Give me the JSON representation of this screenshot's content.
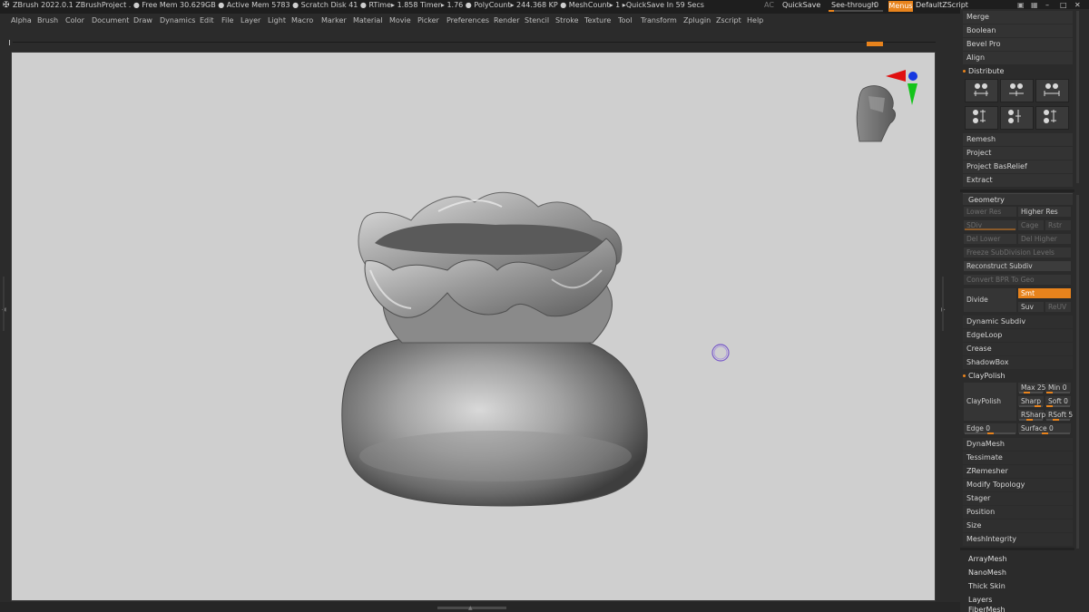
{
  "titlebar": {
    "title": "ZBrush 2022.0.1   ZBrushProject   . ● Free Mem 30.629GB ● Active Mem 5783 ● Scratch Disk 41 ●  RTime▸ 1.858 Timer▸ 1.76 ● PolyCount▸ 244.368 KP  ● MeshCount▸ 1   ▸QuickSave In 59 Secs",
    "ac": "AC",
    "quicksave": "QuickSave",
    "seethrough": "See-through",
    "seethrough_value": "0",
    "menus": "Menus",
    "defaultzscript": "DefaultZScript"
  },
  "menubar": [
    "Alpha",
    "Brush",
    "Color",
    "Document",
    "Draw",
    "Dynamics",
    "Edit",
    "File",
    "Layer",
    "Light",
    "Macro",
    "Marker",
    "Material",
    "Movie",
    "Picker",
    "Preferences",
    "Render",
    "Stencil",
    "Stroke",
    "Texture",
    "Tool",
    "Transform",
    "Zplugin",
    "Zscript",
    "Help"
  ],
  "palette": {
    "top_buttons": [
      "Merge",
      "Boolean",
      "Bevel Pro",
      "Align"
    ],
    "distribute": "Distribute",
    "mid_buttons": [
      "Remesh",
      "Project",
      "Project BasRelief",
      "Extract"
    ],
    "geometry": "Geometry",
    "lower_res": "Lower Res",
    "higher_res": "Higher Res",
    "sdiv": "SDiv",
    "cage": "Cage",
    "rstr": "Rstr",
    "del_lower": "Del Lower",
    "del_higher": "Del Higher",
    "freeze_subdiv": "Freeze SubDivision Levels",
    "reconstruct_subdiv": "Reconstruct Subdiv",
    "convert_bpr": "Convert BPR To Geo",
    "divide": "Divide",
    "smt": "Smt",
    "suv": "Suv",
    "reluv": "ReUV",
    "geo_buttons": [
      "Dynamic Subdiv",
      "EdgeLoop",
      "Crease",
      "ShadowBox"
    ],
    "claypolish_head": "ClayPolish",
    "claypolish_btn": "ClayPolish",
    "max": "Max 25",
    "min": "Min 0",
    "sharp": "Sharp",
    "soft": "Soft 0",
    "rsharp": "RSharp",
    "rsoft": "RSoft 5",
    "edge": "Edge 0",
    "surface": "Surface 0",
    "after_buttons": [
      "DynaMesh",
      "Tessimate",
      "ZRemesher",
      "Modify Topology",
      "Stager",
      "Position",
      "Size",
      "MeshIntegrity"
    ],
    "bottom_items": [
      "ArrayMesh",
      "NanoMesh",
      "Thick Skin",
      "Layers",
      "FiberMesh"
    ]
  },
  "colors": {
    "accent": "#e8831c",
    "canvas": "#cfcfcf",
    "panel": "#2b2b2b"
  }
}
